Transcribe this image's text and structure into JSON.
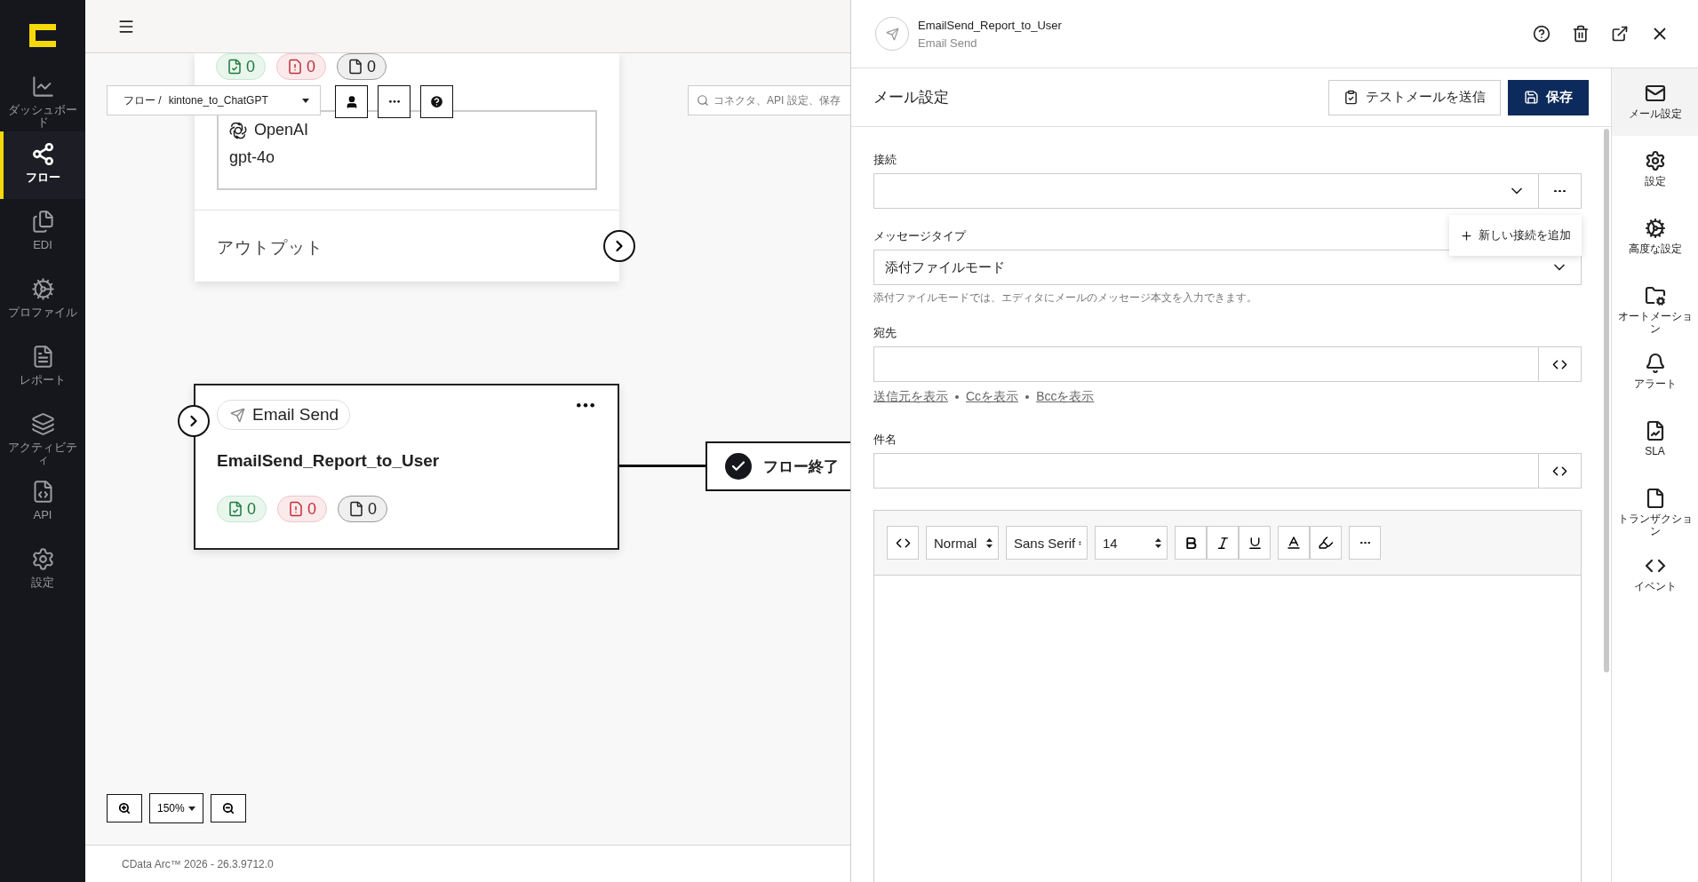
{
  "sidebar": {
    "items": [
      {
        "label": "ダッシュボード",
        "kind": "dashboard",
        "selected": false
      },
      {
        "label": "フロー",
        "kind": "flow",
        "selected": true
      },
      {
        "label": "EDI",
        "kind": "edi",
        "selected": false
      },
      {
        "label": "プロファイル",
        "kind": "profile",
        "selected": false
      },
      {
        "label": "レポート",
        "kind": "report",
        "selected": false
      },
      {
        "label": "アクティビティ",
        "kind": "activity",
        "selected": false
      },
      {
        "label": "API",
        "kind": "api",
        "selected": false
      },
      {
        "label": "設定",
        "kind": "settings",
        "selected": false
      }
    ]
  },
  "breadcrumb": {
    "root": "フロー",
    "separator": "/",
    "flow": "kintone_to_ChatGPT"
  },
  "search": {
    "placeholder": "コネクタ、API 設定、保存"
  },
  "openai_node": {
    "counts": [
      {
        "kind": "success",
        "value": "0"
      },
      {
        "kind": "error",
        "value": "0"
      },
      {
        "kind": "neutral",
        "value": "0"
      }
    ],
    "provider": "OpenAI",
    "model": "gpt-4o",
    "output_label": "アウトプット"
  },
  "email_node": {
    "type_label": "Email Send",
    "title": "EmailSend_Report_to_User",
    "counts": [
      {
        "kind": "success",
        "value": "0"
      },
      {
        "kind": "error",
        "value": "0"
      },
      {
        "kind": "neutral",
        "value": "0"
      }
    ]
  },
  "end_node": {
    "label": "フロー終了"
  },
  "zoom": {
    "level": "150%"
  },
  "footer": "CData Arc™ 2026 - 26.3.9712.0",
  "panel": {
    "title": "EmailSend_Report_to_User",
    "subtitle": "Email Send",
    "section_title": "メール設定",
    "test_button": "テストメールを送信",
    "save_button": "保存",
    "connection": {
      "label": "接続"
    },
    "connection_menu": {
      "items": [
        "新しい接続を追加"
      ]
    },
    "message_type": {
      "label": "メッセージタイプ",
      "value": "添付ファイルモード",
      "hint": "添付ファイルモードでは、エディタにメールのメッセージ本文を入力できます。"
    },
    "to": {
      "label": "宛先"
    },
    "show_links": [
      "送信元を表示",
      "Ccを表示",
      "Bccを表示"
    ],
    "subject": {
      "label": "件名"
    },
    "editor": {
      "format": "Normal",
      "font": "Sans Serif",
      "size": "14"
    },
    "tabs": [
      {
        "label": "メール設定",
        "kind": "mail",
        "selected": true
      },
      {
        "label": "設定",
        "kind": "settings",
        "selected": false
      },
      {
        "label": "高度な設定",
        "kind": "advanced",
        "selected": false
      },
      {
        "label": "オートメーション",
        "kind": "automation",
        "selected": false
      },
      {
        "label": "アラート",
        "kind": "alert",
        "selected": false
      },
      {
        "label": "SLA",
        "kind": "sla",
        "selected": false
      },
      {
        "label": "トランザクション",
        "kind": "transaction",
        "selected": false
      },
      {
        "label": "イベント",
        "kind": "event",
        "selected": false
      }
    ]
  }
}
